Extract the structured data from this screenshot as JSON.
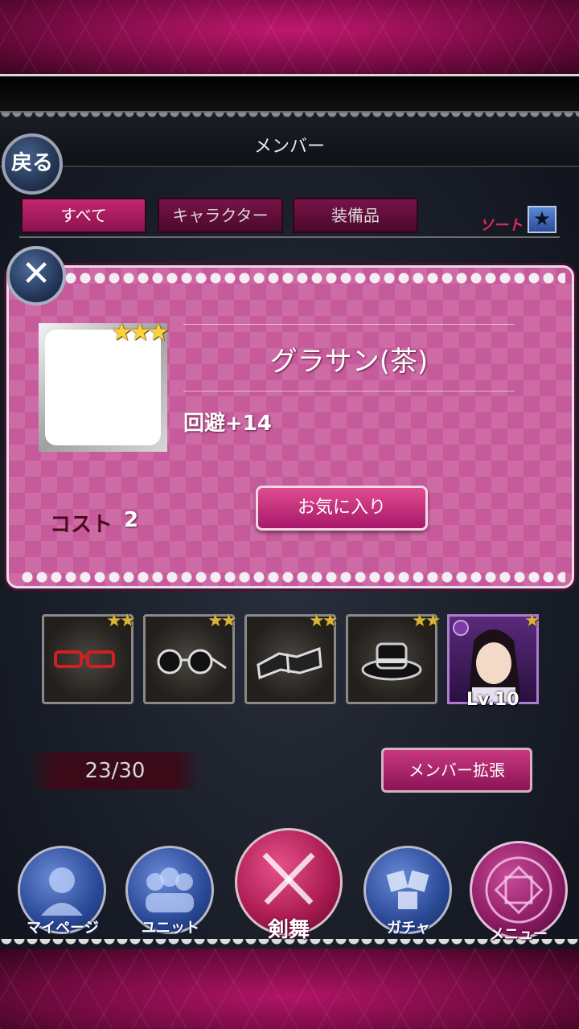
{
  "header": {
    "title": "メンバー",
    "back_label": "戻る"
  },
  "tabs": [
    {
      "label": "すべて",
      "active": true
    },
    {
      "label": "キャラクター",
      "active": false
    },
    {
      "label": "装備品",
      "active": false
    }
  ],
  "sort": {
    "label": "ソート",
    "icon": "star-icon"
  },
  "popup": {
    "close_icon": "close-icon",
    "item_name": "グラサン(茶)",
    "rarity": "★★★",
    "stat": "回避+14",
    "cost_label": "コスト",
    "cost_value": "2",
    "favorite_label": "お気に入り"
  },
  "members": [
    {
      "type": "red-glasses",
      "rarity": "★★"
    },
    {
      "type": "round-glasses",
      "rarity": "★★"
    },
    {
      "type": "wrapped-item",
      "rarity": "★★"
    },
    {
      "type": "black-hat",
      "rarity": "★★"
    },
    {
      "type": "character",
      "rarity": "★",
      "level": "Lv.10"
    }
  ],
  "counter": {
    "value": "23/30"
  },
  "expand_label": "メンバー拡張",
  "nav": {
    "mypage": "マイページ",
    "unit": "ユニット",
    "kenbu": "剣舞",
    "gacha": "ガチャ",
    "menu": "メニュー"
  },
  "colors": {
    "accent": "#c2237a",
    "popup_bg": "#c65a9a",
    "star": "#ffd23a"
  }
}
